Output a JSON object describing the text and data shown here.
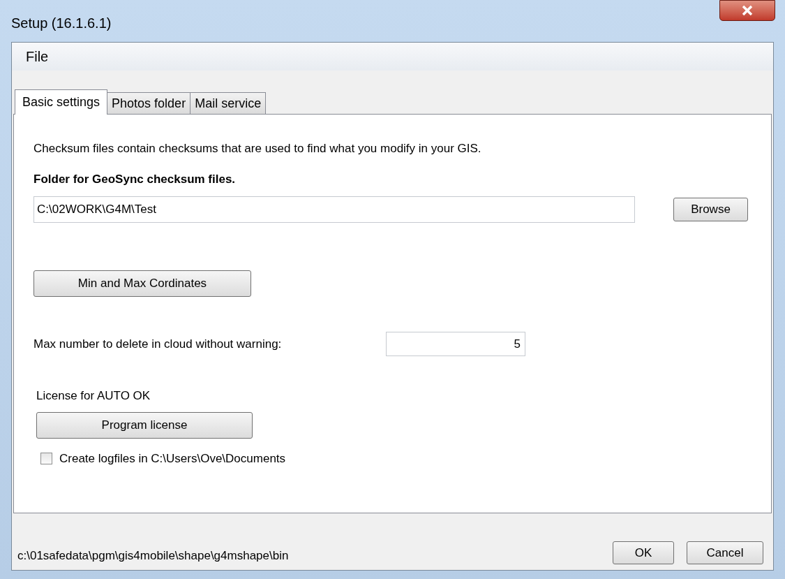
{
  "window": {
    "title": "Setup  (16.1.6.1)"
  },
  "menu": [
    "File"
  ],
  "tabs": [
    {
      "label": "Basic settings",
      "selected": true
    },
    {
      "label": "Photos folder",
      "selected": false
    },
    {
      "label": "Mail service",
      "selected": false
    }
  ],
  "description": "Checksum files contain checksums that are used to find what you modify in your GIS.",
  "folder": {
    "label": "Folder for GeoSync checksum files.",
    "value": "C:\\02WORK\\G4M\\Test",
    "button": "Browse"
  },
  "coordinates_button": "Min and Max Cordinates",
  "max_delete": {
    "label": "Max number to delete in cloud without warning:",
    "value": "5"
  },
  "license": {
    "label": "License for AUTO OK",
    "button": "Program license"
  },
  "logfiles": {
    "label": "Create logfiles in C:\\Users\\Ove\\Documents",
    "checked": false
  },
  "status_path": "c:\\01safedata\\pgm\\gis4mobile\\shape\\g4mshape\\bin",
  "buttons": [
    "OK",
    "Cancel"
  ]
}
